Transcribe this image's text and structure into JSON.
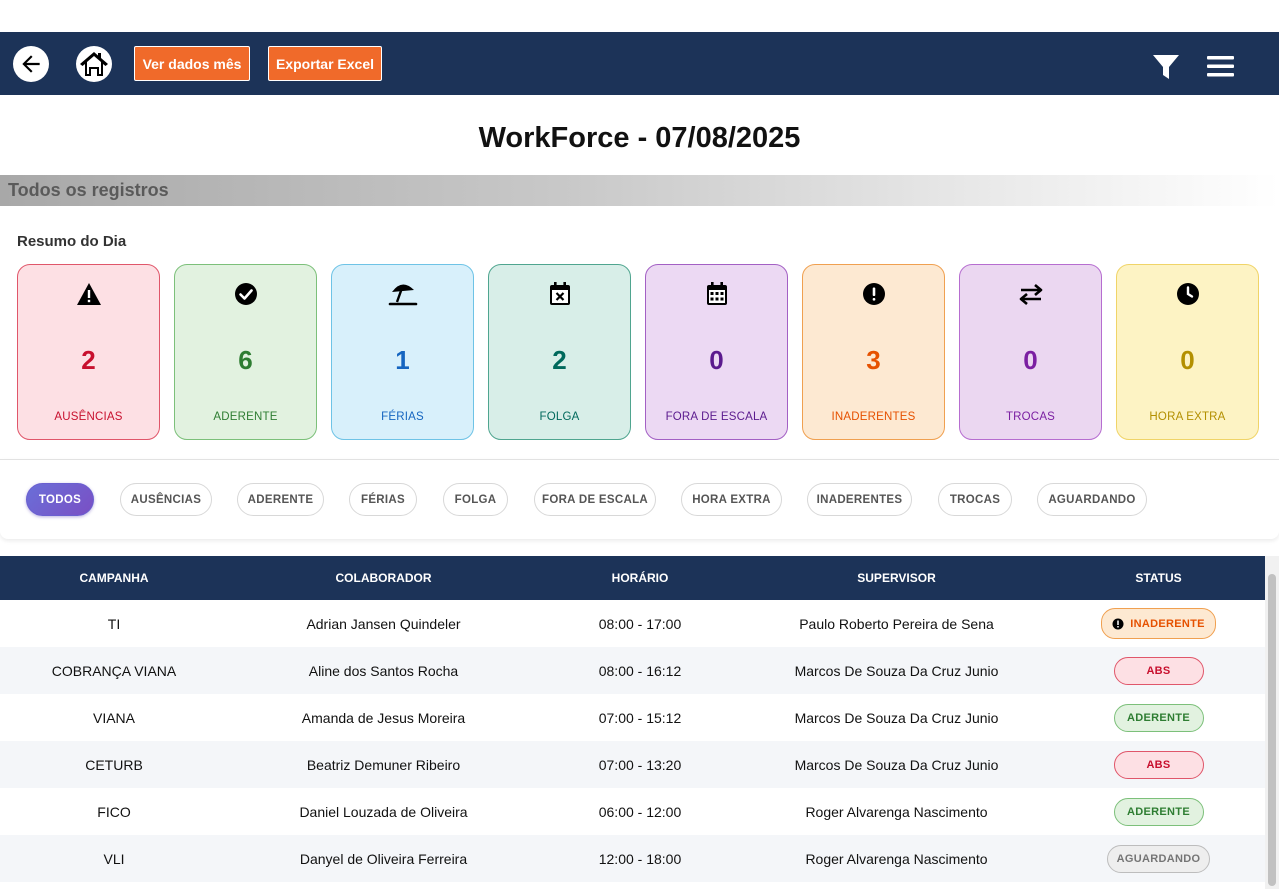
{
  "navbar": {
    "back_icon": "arrow-left-icon",
    "home_icon": "home-icon",
    "btn_month": "Ver dados mês",
    "btn_export": "Exportar Excel",
    "filter_icon": "filter-icon",
    "menu_icon": "hamburger-menu-icon"
  },
  "title": "WorkForce - 07/08/2025",
  "section": "Todos os registros",
  "summary": {
    "title": "Resumo do Dia",
    "cards": [
      {
        "label": "AUSÊNCIAS",
        "value": "2",
        "icon": "warning-icon",
        "color": "#c8102e",
        "bg": "#fde0e4",
        "border": "#e0566a"
      },
      {
        "label": "ADERENTE",
        "value": "6",
        "icon": "check-circle-icon",
        "color": "#2e7d32",
        "bg": "#e2f2e0",
        "border": "#7cc07a"
      },
      {
        "label": "FÉRIAS",
        "value": "1",
        "icon": "umbrella-beach-icon",
        "color": "#1565c0",
        "bg": "#d8f0fb",
        "border": "#6ec3e6"
      },
      {
        "label": "FOLGA",
        "value": "2",
        "icon": "calendar-x-icon",
        "color": "#00695c",
        "bg": "#d8eee8",
        "border": "#4fa58f"
      },
      {
        "label": "FORA DE ESCALA",
        "value": "0",
        "icon": "calendar-icon",
        "color": "#5b1a8e",
        "bg": "#ecd9f3",
        "border": "#a360c4"
      },
      {
        "label": "INADERENTES",
        "value": "3",
        "icon": "exclamation-circle-icon",
        "color": "#e65100",
        "bg": "#fde9d2",
        "border": "#f0a050"
      },
      {
        "label": "TROCAS",
        "value": "0",
        "icon": "swap-icon",
        "color": "#7b1fa2",
        "bg": "#ebd7f1",
        "border": "#b66dd0"
      },
      {
        "label": "HORA EXTRA",
        "value": "0",
        "icon": "clock-icon",
        "color": "#b38f00",
        "bg": "#fdf3c4",
        "border": "#f0d468"
      }
    ]
  },
  "filters": [
    "TODOS",
    "AUSÊNCIAS",
    "ADERENTE",
    "FÉRIAS",
    "FOLGA",
    "FORA DE ESCALA",
    "HORA EXTRA",
    "INADERENTES",
    "TROCAS",
    "AGUARDANDO"
  ],
  "table": {
    "headers": [
      "CAMPANHA",
      "COLABORADOR",
      "HORÁRIO",
      "SUPERVISOR",
      "STATUS"
    ],
    "rows": [
      {
        "campanha": "TI",
        "colaborador": "Adrian Jansen Quindeler",
        "horario": "08:00 - 17:00",
        "supervisor": "Paulo Roberto Pereira de Sena",
        "status": "INADERENTE"
      },
      {
        "campanha": "COBRANÇA VIANA",
        "colaborador": "Aline dos Santos Rocha",
        "horario": "08:00 - 16:12",
        "supervisor": "Marcos De Souza Da Cruz Junio",
        "status": "ABS"
      },
      {
        "campanha": "VIANA",
        "colaborador": "Amanda de Jesus Moreira",
        "horario": "07:00 - 15:12",
        "supervisor": "Marcos De Souza Da Cruz Junio",
        "status": "ADERENTE"
      },
      {
        "campanha": "CETURB",
        "colaborador": "Beatriz Demuner Ribeiro",
        "horario": "07:00 - 13:20",
        "supervisor": "Marcos De Souza Da Cruz Junio",
        "status": "ABS"
      },
      {
        "campanha": "FICO",
        "colaborador": "Daniel Louzada de Oliveira",
        "horario": "06:00 - 12:00",
        "supervisor": "Roger Alvarenga Nascimento",
        "status": "ADERENTE"
      },
      {
        "campanha": "VLI",
        "colaborador": "Danyel de Oliveira Ferreira",
        "horario": "12:00 - 18:00",
        "supervisor": "Roger Alvarenga Nascimento",
        "status": "AGUARDANDO"
      }
    ]
  }
}
